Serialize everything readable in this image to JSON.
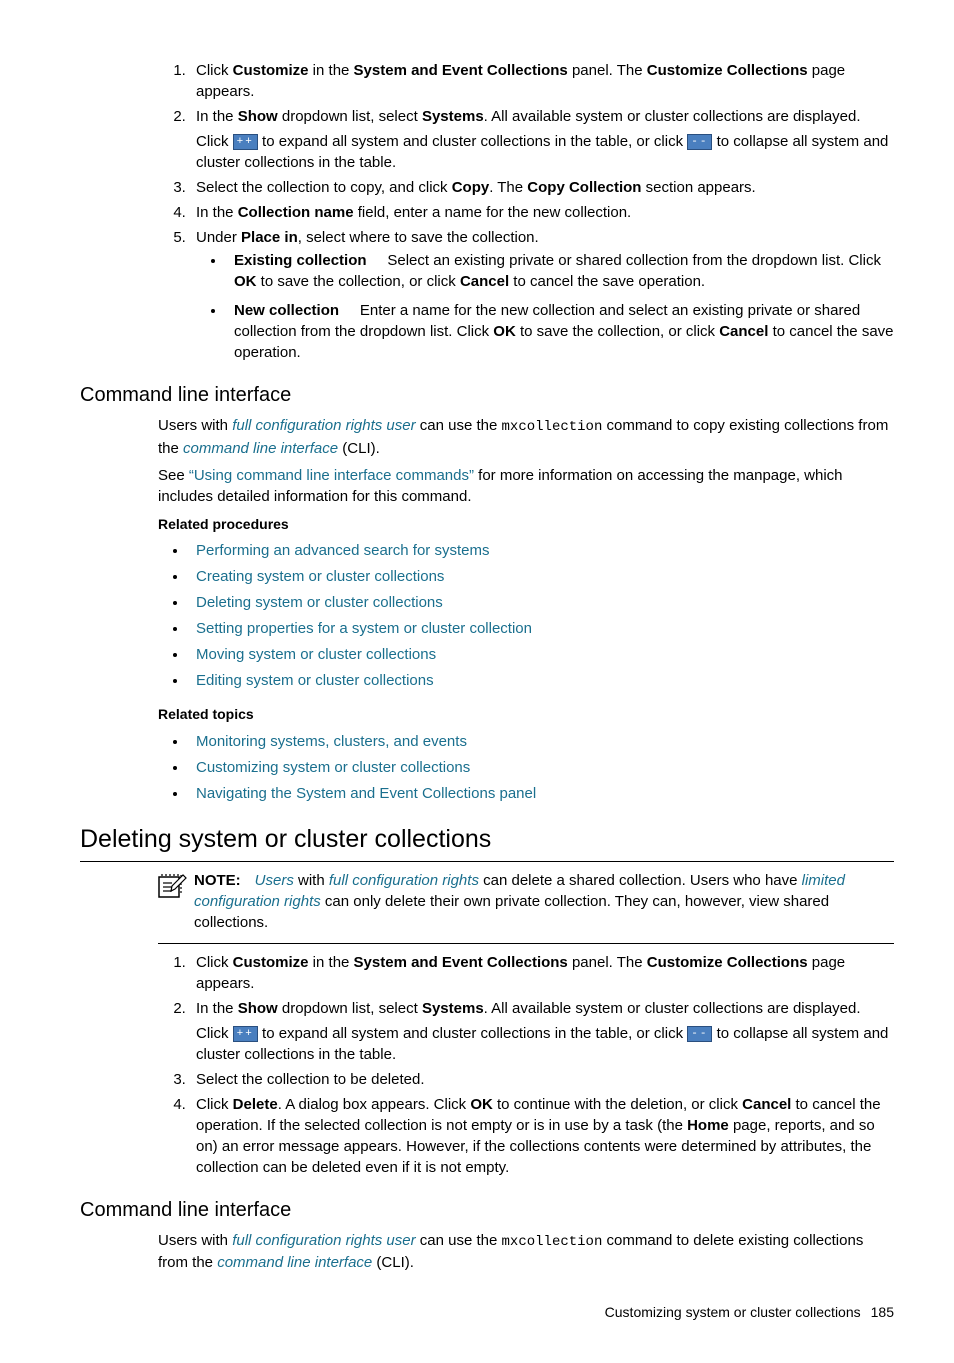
{
  "step1_a": "Click ",
  "step1_b": "Customize",
  "step1_c": " in the ",
  "step1_d": "System and Event Collections",
  "step1_e": " panel. The ",
  "step1_f": "Customize Collections",
  "step1_g": " page appears.",
  "step2_a": "In the ",
  "step2_b": "Show",
  "step2_c": " dropdown list, select ",
  "step2_d": "Systems",
  "step2_e": ". All available system or cluster collections are displayed.",
  "step2_sub_a": "Click ",
  "step2_sub_b": " to expand all system and cluster collections in the table, or click ",
  "step2_sub_c": " to collapse all system and cluster collections in the table.",
  "step3_a": "Select the collection to copy, and click ",
  "step3_b": "Copy",
  "step3_c": ". The ",
  "step3_d": "Copy Collection",
  "step3_e": " section appears.",
  "step4_a": "In the ",
  "step4_b": "Collection name",
  "step4_c": " field, enter a name for the new collection.",
  "step5_a": "Under ",
  "step5_b": "Place in",
  "step5_c": ", select where to save the collection.",
  "b1_a": "Existing collection",
  "b1_b": "Select an existing private or shared collection from the dropdown list. Click ",
  "b1_c": "OK",
  "b1_d": " to save the collection, or click ",
  "b1_e": "Cancel",
  "b1_f": " to cancel the save operation.",
  "b2_a": "New collection",
  "b2_b": "Enter a name for the new collection and select an existing private or shared collection from the dropdown list. Click ",
  "b2_c": "OK",
  "b2_d": " to save the collection, or click ",
  "b2_e": "Cancel",
  "b2_f": " to cancel the save operation.",
  "cli_head": "Command line interface",
  "cli_p1_a": "Users with ",
  "cli_p1_b": "full configuration rights user",
  "cli_p1_c": " can use the ",
  "cli_p1_d": "mxcollection",
  "cli_p1_e": " command to copy existing collections from the ",
  "cli_p1_f": "command line interface",
  "cli_p1_g": " (CLI).",
  "cli_p2_a": "See ",
  "cli_p2_b": "“Using command line interface commands”",
  "cli_p2_c": " for more information on accessing the manpage, which includes detailed information for this command.",
  "rel_proc": "Related procedures",
  "rp1": "Performing an advanced search for systems",
  "rp2": "Creating system or cluster collections",
  "rp3": "Deleting system or cluster collections",
  "rp4": "Setting properties for a system or cluster collection",
  "rp5": "Moving system or cluster collections",
  "rp6": "Editing system or cluster collections",
  "rel_top": "Related topics",
  "rt1": "Monitoring systems, clusters, and events",
  "rt2": "Customizing system or cluster collections",
  "rt3": "Navigating the System and Event Collections panel",
  "sec2_head": "Deleting system or cluster collections",
  "note_label": "NOTE:",
  "note_a": "Users",
  "note_b": " with ",
  "note_c": "full configuration rights",
  "note_d": " can delete a shared collection. Users who have ",
  "note_e": "limited configuration rights",
  "note_f": " can only delete their own private collection. They can, however, view shared collections.",
  "d3": "Select the collection to be deleted.",
  "d4_a": "Click ",
  "d4_b": "Delete",
  "d4_c": ". A dialog box appears. Click ",
  "d4_d": "OK",
  "d4_e": " to continue with the deletion, or click ",
  "d4_f": "Cancel",
  "d4_g": " to cancel the operation. If the selected collection is not empty or is in use by a task (the ",
  "d4_h": "Home",
  "d4_i": " page, reports, and so on) an error message appears. However, if the collections contents were determined by attributes, the collection can be deleted even if it is not empty.",
  "cli2_p1_e": " command to delete existing collections from the ",
  "footer_text": "Customizing system or cluster collections",
  "footer_page": "185",
  "icon_expand": "++",
  "icon_collapse": "--"
}
